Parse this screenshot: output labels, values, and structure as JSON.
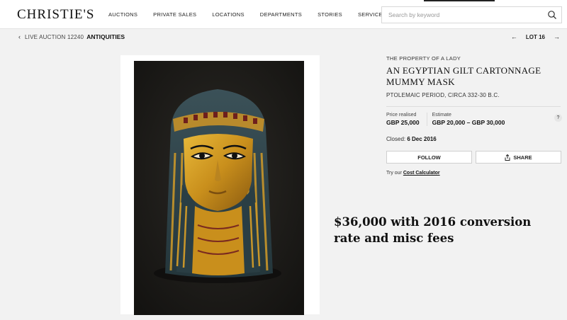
{
  "header": {
    "logo": "CHRISTIE'S",
    "nav": [
      "AUCTIONS",
      "PRIVATE SALES",
      "LOCATIONS",
      "DEPARTMENTS",
      "STORIES",
      "SERVICES"
    ],
    "search_placeholder": "Search by keyword"
  },
  "breadcrumb": {
    "auction": "LIVE AUCTION 12240",
    "department": "ANTIQUITIES"
  },
  "lot_nav": {
    "label": "LOT 16"
  },
  "lot": {
    "provenance": "THE PROPERTY OF A LADY",
    "title": "AN EGYPTIAN GILT CARTONNAGE MUMMY MASK",
    "period": "PTOLEMAIC PERIOD, CIRCA 332-30 B.C.",
    "price_realised_label": "Price realised",
    "price_realised": "GBP 25,000",
    "estimate_label": "Estimate",
    "estimate": "GBP 20,000 – GBP 30,000",
    "help_glyph": "?",
    "closed_label": "Closed:",
    "closed_date": "6 Dec 2016",
    "follow_label": "FOLLOW",
    "share_label": "SHARE",
    "calc_prefix": "Try our",
    "calc_link": "Cost Calculator"
  },
  "annotation": "$36,000 with 2016 conversion rate and misc fees",
  "icons": {
    "search": "search-icon",
    "chevron_left": "chevron-left-icon",
    "arrow_left": "arrow-left-icon",
    "arrow_right": "arrow-right-icon",
    "share": "share-icon"
  },
  "colors": {
    "background": "#f2f2f2",
    "header": "#ffffff",
    "text": "#222222"
  }
}
